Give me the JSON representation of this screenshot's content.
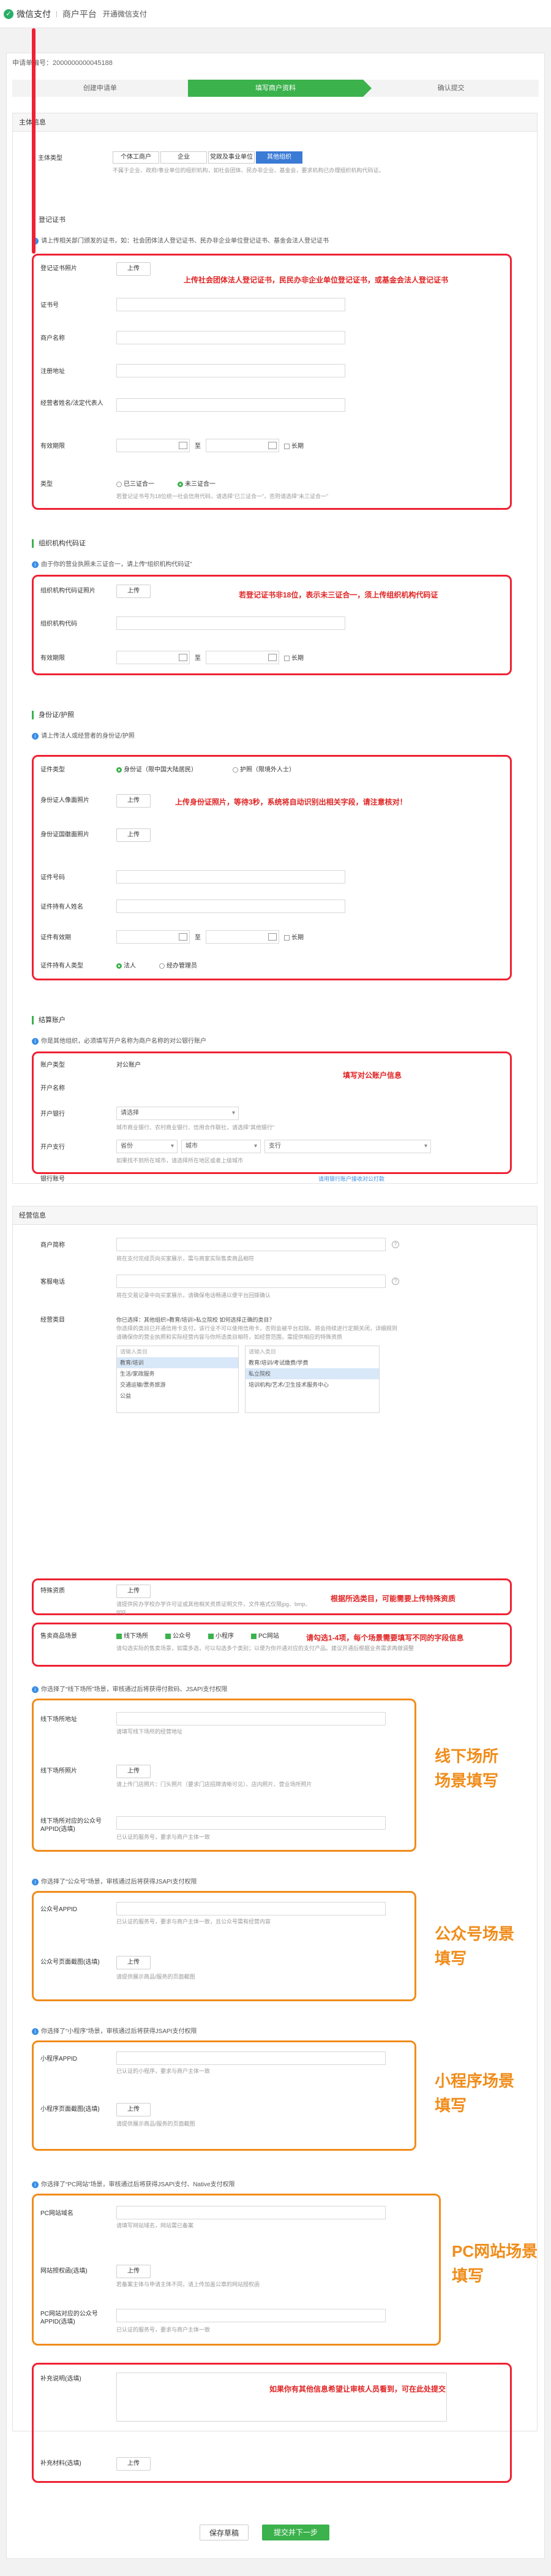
{
  "header": {
    "logo": "微信支付",
    "separator": "|",
    "platform": "商户平台",
    "subtitle": "开通微信支付"
  },
  "application_no": "申请单编号：2000000000045188",
  "steps": [
    "创建申请单",
    "填写商户资料",
    "确认提交"
  ],
  "subject": {
    "title": "主体信息",
    "type_label": "主体类型",
    "types": [
      "个体工商户",
      "企业",
      "党政及事业单位",
      "其他组织"
    ],
    "type_hint": "不属于企业、政府/事业单位的组织机构，如社会团体、民办非企业、基金会，要求机构已办理组织机构代码证。"
  },
  "registration": {
    "section": "登记证书",
    "tip": "请上传相关部门颁发的证书，如：社会团体法人登记证书、民办非企业单位登记证书、基金会法人登记证书",
    "fields": [
      {
        "label": "登记证书照片",
        "button": "上传",
        "hint": ""
      },
      {
        "label": "证书号"
      },
      {
        "label": "商户名称"
      },
      {
        "label": "注册地址"
      },
      {
        "label": "经营者姓名/法定代表人"
      },
      {
        "label": "有效期限",
        "to": "至",
        "long": "长期"
      },
      {
        "label": "类型"
      }
    ],
    "type_options": [
      "已三证合一",
      "未三证合一"
    ],
    "type_hint": "若登记证书号为18位统一社会信用代码，请选择“已三证合一”，否则请选择“未三证合一”",
    "annotation": "上传社会团体法人登记证书，民民办非企业单位登记证书，或基金会法人登记证书"
  },
  "orgcode": {
    "section": "组织机构代码证",
    "tip": "由于你的营业执照未三证合一，请上传“组织机构代码证”",
    "fields": [
      {
        "label": "组织机构代码证照片",
        "button": "上传"
      },
      {
        "label": "组织机构代码"
      },
      {
        "label": "有效期限",
        "to": "至",
        "long": "长期"
      }
    ],
    "annotation": "若登记证书非18位，表示未三证合一，须上传组织机构代码证"
  },
  "identity": {
    "section": "身份证/护照",
    "tip": "请上传法人或经营者的身份证/护照",
    "type_label": "证件类型",
    "type_options": [
      "身份证（限中国大陆居民）",
      "护照（限境外人士）"
    ],
    "fields": [
      {
        "label": "身份证人像面照片",
        "button": "上传"
      },
      {
        "label": "身份证国徽面照片",
        "button": "上传"
      },
      {
        "label": "证件号码"
      },
      {
        "label": "证件持有人姓名"
      },
      {
        "label": "证件有效期",
        "to": "至",
        "long": "长期"
      },
      {
        "label": "证件持有人类型"
      }
    ],
    "holder_options": [
      "法人",
      "经办管理员"
    ],
    "annotation": "上传身份证照片，等待3秒，系统将自动识别出相关字段，请注意核对！"
  },
  "bank": {
    "section": "结算账户",
    "tip": "你是其他组织，必须填写开户名称为商户名称的对公银行账户",
    "fields": [
      {
        "label": "账户类型",
        "value": "对公账户"
      },
      {
        "label": "开户名称"
      },
      {
        "label": "开户银行",
        "placeholder": "请选择"
      },
      {
        "label": "开户支行",
        "province": "省份",
        "city": "城市",
        "branch": "支行"
      },
      {
        "label": "银行账号"
      }
    ],
    "bank_hint": "城市商业银行、农村商业银行、信用合作联社，请选择“其他银行”",
    "branch_hint": "如果找不到所在城市，请选择所在地区或者上级城市",
    "account_link": "请用银行账户接收对公打款",
    "annotation": "填写对公账户信息"
  },
  "business": {
    "title": "经营信息",
    "fields": [
      {
        "label": "商户简称",
        "hint": "将在支付完成页向买家展示，需与商家实际售卖商品相符"
      },
      {
        "label": "客服电话",
        "hint": "将在交易记录中向买家展示，请确保电话畅通以便平台回拨确认"
      },
      {
        "label": "经营类目"
      }
    ],
    "category_hint": "你已选择：其他组织>教育/培训>私立院校 如何选择正确的类目？",
    "category_hint2": "你选择的类目已开通信用卡支付，该行业不可以使用信用卡，否则会被平台扣除。将会持续进行定期关闭，详细规则",
    "category_hint3": "请确保你的营业执照和实际经营内容与你所选类目相符，如经营范围，需提供相应的特殊资质",
    "categories_l1": [
      "教育/培训",
      "生活/家政服务",
      "交通运输/票务旅游",
      "公益"
    ],
    "categories_l2": [
      "教育/培训/考试缴费/学费",
      "私立院校",
      "培训机构/艺术/卫生技术服务中心"
    ],
    "search_ph": "请输入类目",
    "special_label": "特殊资质",
    "special_button": "上传",
    "special_hint": "请提供民办学校办学许可证或其他相关资质证明文件，文件格式仅限jpg、bmp、png",
    "special_annotation": "根据所选类目，可能需要上传特殊资质",
    "scene_label": "售卖商品场景",
    "scenes": [
      "线下场所",
      "公众号",
      "小程序",
      "PC网站"
    ],
    "scene_hint": "请勾选实际的售卖场景，如需多选，可以勾选多个类别；以便为你开通对应的支付产品。建议开通后根据业务需求再做调整",
    "scene_annotation": "请勾选1-4项，每个场景需要填写不同的字段信息"
  },
  "offline": {
    "tip": "你选择了“线下场所”场景，审核通过后将获得付款码、JSAPI支付权限",
    "fields": [
      {
        "label": "线下场所地址",
        "hint": "请填写线下场所的经营地址"
      },
      {
        "label": "线下场所照片",
        "button": "上传",
        "hint": "请上传门店照片：门头照片（要求门店招牌清晰可见）、店内照片、营业场所照片"
      },
      {
        "label": "线下场所对应的公众号APPID(选填)",
        "hint": "已认证的服务号，要求与商户主体一致"
      }
    ],
    "annotation": "线下场所场景填写"
  },
  "mp": {
    "tip": "你选择了“公众号”场景，审核通过后将获得JSAPI支付权限",
    "fields": [
      {
        "label": "公众号APPID",
        "hint": "已认证的服务号，要求与商户主体一致，且公众号需有经营内容"
      },
      {
        "label": "公众号页面截图(选填)",
        "button": "上传",
        "hint": "请提供展示商品/服务的页面截图"
      }
    ],
    "annotation": "公众号场景填写"
  },
  "mini": {
    "tip": "你选择了“小程序”场景，审核通过后将获得JSAPI支付权限",
    "fields": [
      {
        "label": "小程序APPID",
        "hint": "已认证的小程序，要求与商户主体一致"
      },
      {
        "label": "小程序页面截图(选填)",
        "button": "上传",
        "hint": "请提供展示商品/服务的页面截图"
      }
    ],
    "annotation": "小程序场景填写"
  },
  "pc": {
    "tip": "你选择了“PC网站”场景，审核通过后将获得JSAPI支付、Native支付权限",
    "fields": [
      {
        "label": "PC网站域名",
        "hint": "请填写网站域名，网站需已备案"
      },
      {
        "label": "网站授权函(选填)",
        "button": "上传",
        "hint": "若备案主体与申请主体不同，请上传加盖公章的网站授权函"
      },
      {
        "label": "PC网站对应的公众号APPID(选填)",
        "hint": "已认证的服务号，要求与商户主体一致"
      }
    ],
    "annotation": "PC网站场景填写"
  },
  "extra": {
    "fields": [
      {
        "label": "补充说明(选填)"
      },
      {
        "label": "补充材料(选填)",
        "button": "上传"
      }
    ],
    "annotation": "如果你有其他信息希望让审核人员看到，可在此处提交"
  },
  "footer": {
    "save": "保存草稿",
    "next": "提交并下一步"
  }
}
